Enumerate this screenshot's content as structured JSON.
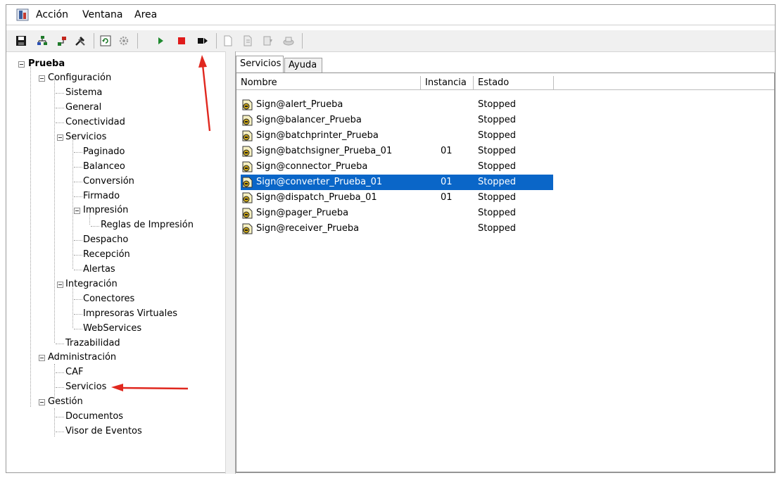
{
  "menubar": {
    "items": [
      "Acción",
      "Ventana",
      "Area"
    ]
  },
  "toolbar": {
    "buttons": [
      {
        "icon": "save-icon"
      },
      {
        "icon": "network-icon"
      },
      {
        "icon": "node-icon"
      },
      {
        "icon": "tools-icon"
      },
      {
        "icon": "refresh-icon"
      },
      {
        "icon": "gear-icon"
      },
      {
        "icon": "play-icon"
      },
      {
        "icon": "stop-icon"
      },
      {
        "icon": "step-icon"
      },
      {
        "icon": "new-document-icon"
      },
      {
        "icon": "export-icon"
      },
      {
        "icon": "import-icon"
      },
      {
        "icon": "disk-icon"
      }
    ]
  },
  "tree": {
    "root": "Prueba",
    "configuracion": "Configuración",
    "sistema": "Sistema",
    "general": "General",
    "conectividad": "Conectividad",
    "servicios": "Servicios",
    "paginado": "Paginado",
    "balanceo": "Balanceo",
    "conversion": "Conversión",
    "firmado": "Firmado",
    "impresion": "Impresión",
    "reglas_impresion": "Reglas de Impresión",
    "despacho": "Despacho",
    "recepcion": "Recepción",
    "alertas": "Alertas",
    "integracion": "Integración",
    "conectores": "Conectores",
    "impresoras_virtuales": "Impresoras Virtuales",
    "webservices": "WebServices",
    "trazabilidad": "Trazabilidad",
    "administracion": "Administración",
    "caf": "CAF",
    "admin_servicios": "Servicios",
    "gestion": "Gestión",
    "documentos": "Documentos",
    "visor_eventos": "Visor de Eventos"
  },
  "tabs": [
    "Servicios",
    "Ayuda"
  ],
  "listview": {
    "columns": [
      "Nombre",
      "Instancia",
      "Estado"
    ],
    "rows": [
      {
        "name": "Sign@alert_Prueba",
        "instance": "",
        "state": "Stopped",
        "selected": false
      },
      {
        "name": "Sign@balancer_Prueba",
        "instance": "",
        "state": "Stopped",
        "selected": false
      },
      {
        "name": "Sign@batchprinter_Prueba",
        "instance": "",
        "state": "Stopped",
        "selected": false
      },
      {
        "name": "Sign@batchsigner_Prueba_01",
        "instance": "01",
        "state": "Stopped",
        "selected": false
      },
      {
        "name": "Sign@connector_Prueba",
        "instance": "",
        "state": "Stopped",
        "selected": false
      },
      {
        "name": "Sign@converter_Prueba_01",
        "instance": "01",
        "state": "Stopped",
        "selected": true
      },
      {
        "name": "Sign@dispatch_Prueba_01",
        "instance": "01",
        "state": "Stopped",
        "selected": false
      },
      {
        "name": "Sign@pager_Prueba",
        "instance": "",
        "state": "Stopped",
        "selected": false
      },
      {
        "name": "Sign@receiver_Prueba",
        "instance": "",
        "state": "Stopped",
        "selected": false
      }
    ]
  },
  "colors": {
    "selection": "#0a66c8",
    "annotation_arrow": "#e0281f"
  }
}
